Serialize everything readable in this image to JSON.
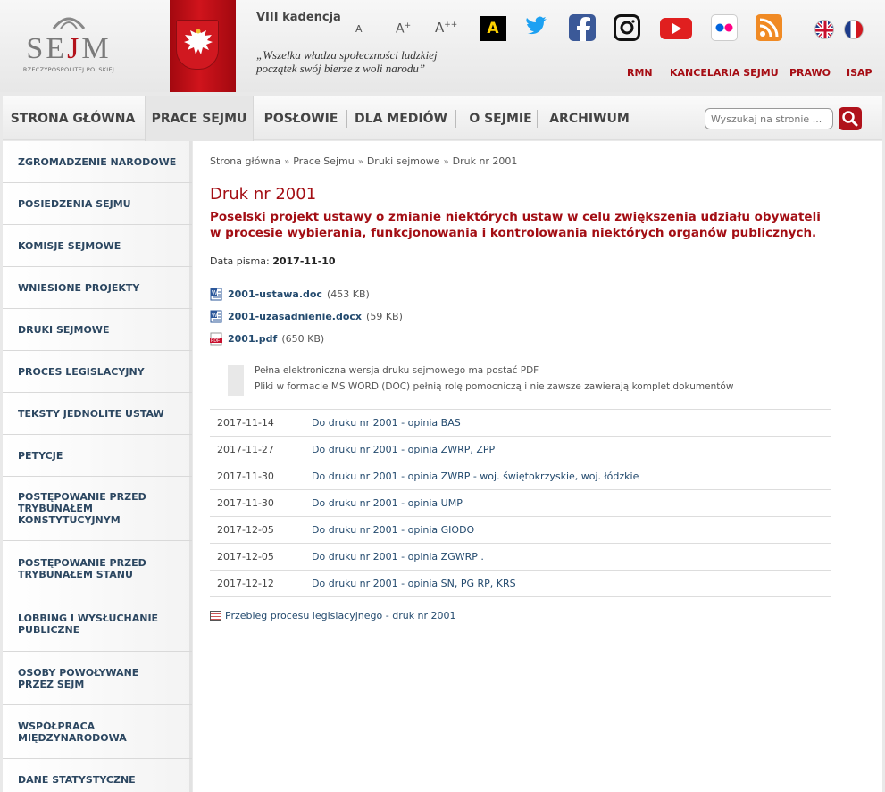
{
  "header": {
    "logo_text": "SEJM",
    "logo_subtitle": "RZECZYPOSPOLITEJ POLSKIEJ",
    "kadencja": "VIII kadencja",
    "motto": "„Wszelka władza społeczności ludzkiej początek swój bierze z woli narodu”",
    "font_small": "A",
    "font_medium": "A",
    "font_medium_sup": "+",
    "font_large": "A",
    "font_large_sup": "++",
    "contrast_label": "A",
    "social_icons": [
      "twitter-icon",
      "facebook-icon",
      "instagram-icon",
      "youtube-icon",
      "flickr-icon",
      "rss-icon"
    ],
    "languages": [
      "english-flag-icon",
      "french-flag-icon"
    ],
    "top_links": [
      "RMN",
      "KANCELARIA SEJMU",
      "PRAWO",
      "ISAP"
    ]
  },
  "nav": {
    "items": [
      "STRONA GŁÓWNA",
      "PRACE SEJMU",
      "POSŁOWIE",
      "DLA MEDIÓW",
      "O SEJMIE",
      "ARCHIWUM"
    ],
    "active": "PRACE SEJMU",
    "search_placeholder": "Wyszukaj na stronie ..."
  },
  "sidebar": {
    "items": [
      "ZGROMADZENIE NARODOWE",
      "POSIEDZENIA SEJMU",
      "KOMISJE SEJMOWE",
      "WNIESIONE PROJEKTY",
      "DRUKI SEJMOWE",
      "PROCES LEGISLACYJNY",
      "TEKSTY JEDNOLITE USTAW",
      "PETYCJE",
      "POSTĘPOWANIE PRZED TRYBUNAŁEM KONSTYTUCYJNYM",
      "POSTĘPOWANIE PRZED TRYBUNAŁEM STANU",
      "LOBBING I WYSŁUCHANIE PUBLICZNE",
      "OSOBY POWOŁYWANE PRZEZ SEJM",
      "WSPÓŁPRACA MIĘDZYNARODOWA",
      "DANE STATYSTYCZNE"
    ]
  },
  "breadcrumb": [
    "Strona główna",
    "Prace Sejmu",
    "Druki sejmowe",
    "Druk nr 2001"
  ],
  "breadcrumb_sep": "»",
  "main": {
    "title": "Druk nr 2001",
    "subtitle": "Poselski projekt ustawy o zmianie niektórych ustaw w celu zwiększenia udziału obywateli w procesie wybierania, funkcjonowania i kontrolowania niektórych organów publicznych.",
    "date_label": "Data pisma:",
    "date_value": "2017-11-10",
    "files": [
      {
        "name": "2001-ustawa.doc",
        "size": "(453 KB)",
        "icon": "word-doc-icon"
      },
      {
        "name": "2001-uzasadnienie.docx",
        "size": "(59 KB)",
        "icon": "word-doc-icon"
      },
      {
        "name": "2001.pdf",
        "size": "(650 KB)",
        "icon": "pdf-icon"
      }
    ],
    "note_line1": "Pełna elektroniczna wersja druku sejmowego ma postać PDF",
    "note_line2": "Pliki w formacie MS WORD (DOC) pełnią rolę pomocniczą i nie zawsze zawierają komplet dokumentów",
    "opinions": [
      {
        "date": "2017-11-14",
        "text": "Do druku nr 2001 - opinia BAS"
      },
      {
        "date": "2017-11-27",
        "text": "Do druku nr 2001 - opinia ZWRP, ZPP"
      },
      {
        "date": "2017-11-30",
        "text": "Do druku nr 2001 - opinia ZWRP - woj. świętokrzyskie, woj. łódzkie"
      },
      {
        "date": "2017-11-30",
        "text": "Do druku nr 2001 - opinia UMP"
      },
      {
        "date": "2017-12-05",
        "text": "Do druku nr 2001 - opinia GIODO"
      },
      {
        "date": "2017-12-05",
        "text": "Do druku nr 2001 - opinia ZGWRP ."
      },
      {
        "date": "2017-12-12",
        "text": "Do druku nr 2001 - opinia SN, PG RP, KRS"
      }
    ],
    "process_link": "Przebieg procesu legislacyjnego - druk nr 2001"
  },
  "colors": {
    "accent_red": "#a30e14",
    "link_blue": "#234a6e",
    "sidebar_text": "#2c4761"
  }
}
